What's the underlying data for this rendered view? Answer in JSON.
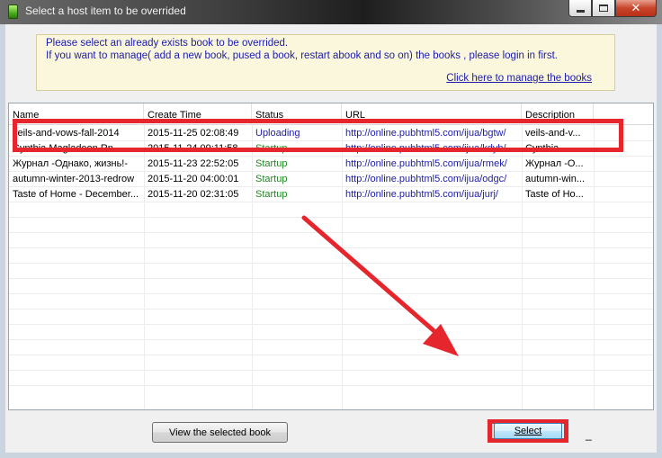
{
  "window": {
    "title": "Select a host item to be overrided",
    "close_glyph": "✕"
  },
  "info": {
    "line1": "Please select an already exists book to be overrided.",
    "line2": "If you want to manage( add a new book, pused a book, restart abook and so on) the books , please login in first.",
    "link": "Click here to manage the books"
  },
  "table": {
    "columns": [
      "Name",
      "Create Time",
      "Status",
      "URL",
      "Description"
    ],
    "rows": [
      {
        "name": "veils-and-vows-fall-2014",
        "time": "2015-11-25 02:08:49",
        "status": "Uploading",
        "url": "http://online.pubhtml5.com/ijua/bgtw/",
        "desc": "veils-and-v..."
      },
      {
        "name": "Cynthia Magladeon Rn",
        "time": "2015-11-24 09:11:58",
        "status": "Startup",
        "url": "http://online.pubhtml5.com/ijua/kdyb/",
        "desc": "Cynthia..."
      },
      {
        "name": "Журнал -Однако, жизнь!-",
        "time": "2015-11-23 22:52:05",
        "status": "Startup",
        "url": "http://online.pubhtml5.com/ijua/rmek/",
        "desc": "Журнал -О..."
      },
      {
        "name": "autumn-winter-2013-redrow",
        "time": "2015-11-20 04:00:01",
        "status": "Startup",
        "url": "http://online.pubhtml5.com/ijua/odgc/",
        "desc": "autumn-win..."
      },
      {
        "name": "Taste of Home - December...",
        "time": "2015-11-20 02:31:05",
        "status": "Startup",
        "url": "http://online.pubhtml5.com/ijua/jurj/",
        "desc": "Taste of Ho..."
      }
    ]
  },
  "buttons": {
    "view": "View the selected book",
    "select": "Select",
    "underscore": "_"
  },
  "colors": {
    "highlight": "#e6262d",
    "status_uploading": "#1c1ca8",
    "status_startup": "#1f8a1f"
  }
}
